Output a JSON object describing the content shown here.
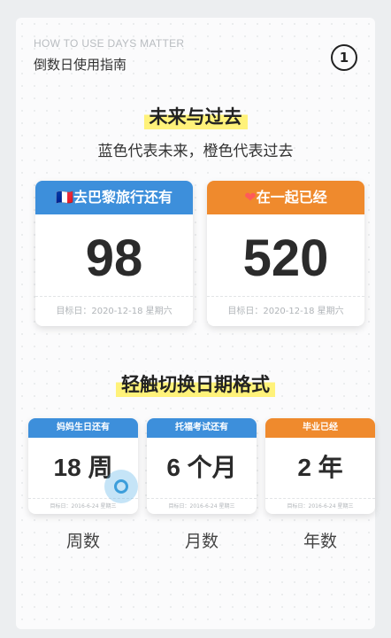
{
  "header": {
    "title_en": "HOW TO USE DAYS MATTER",
    "title_cn": "倒数日使用指南",
    "step": "1"
  },
  "section1": {
    "title": "未来与过去",
    "subtitle": "蓝色代表未来，橙色代表过去",
    "cards": [
      {
        "icon": "🇫🇷",
        "icon_name": "france-flag-icon",
        "title": "去巴黎旅行还有",
        "value": "98",
        "footer": "目标日：2020-12-18 星期六",
        "color": "#3d8fdb"
      },
      {
        "icon": "❤",
        "icon_name": "heart-icon",
        "title": "在一起已经",
        "value": "520",
        "footer": "目标日：2020-12-18 星期六",
        "color": "#ef8a2d"
      }
    ]
  },
  "section2": {
    "title": "轻触切换日期格式",
    "cards": [
      {
        "title": "妈妈生日还有",
        "value": "18 周",
        "footer": "目标日：2016-6-24 星期三",
        "label": "周数",
        "color": "#3d8fdb"
      },
      {
        "title": "托福考试还有",
        "value": "6 个月",
        "footer": "目标日：2016-6-24 星期三",
        "label": "月数",
        "color": "#3d8fdb"
      },
      {
        "title": "毕业已经",
        "value": "2 年",
        "footer": "目标日：2016-6-24 星期三",
        "label": "年数",
        "color": "#ef8a2d"
      }
    ]
  }
}
